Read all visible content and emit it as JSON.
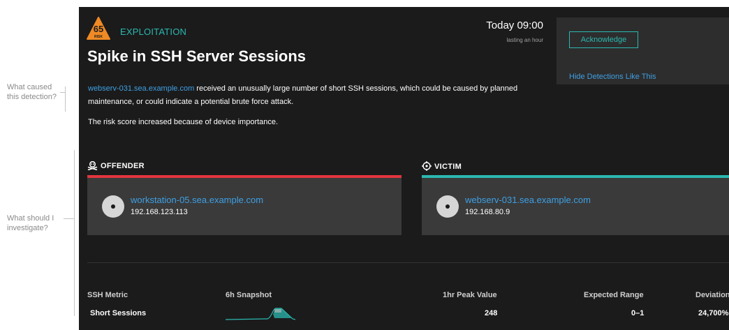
{
  "annotations": {
    "cause": [
      "What caused",
      "this detection?"
    ],
    "investigate": [
      "What should I",
      "investigate?"
    ]
  },
  "detection": {
    "risk_score": "65",
    "risk_label": "RISK",
    "category": "EXPLOITATION",
    "title": "Spike in SSH Server Sessions",
    "time": "Today 09:00",
    "duration": "lasting an hour",
    "acknowledge_label": "Acknowledge",
    "hide_label": "Hide Detections Like This",
    "description_link": "webserv-031.sea.example.com",
    "description_text": " received an unusually large number of short SSH sessions, which could be caused by planned maintenance, or could indicate a potential brute force attack.",
    "risk_note": "The risk score increased because of device importance."
  },
  "offender": {
    "label": "OFFENDER",
    "hostname": "workstation-05.sea.example.com",
    "ip": "192.168.123.113"
  },
  "victim": {
    "label": "VICTIM",
    "hostname": "webserv-031.sea.example.com",
    "ip": "192.168.80.9"
  },
  "metrics": {
    "headers": {
      "metric": "SSH Metric",
      "snapshot": "6h Snapshot",
      "peak": "1hr Peak Value",
      "range": "Expected Range",
      "deviation": "Deviation"
    },
    "rows": [
      {
        "metric": "Short Sessions",
        "peak": "248",
        "range": "0–1",
        "deviation": "24,700%"
      }
    ]
  },
  "colors": {
    "accent_teal": "#2bb8b0",
    "link_blue": "#3ea0e4",
    "offender_red": "#e2353f",
    "risk_orange": "#f08a24",
    "panel_bg": "#1b1b1b"
  }
}
